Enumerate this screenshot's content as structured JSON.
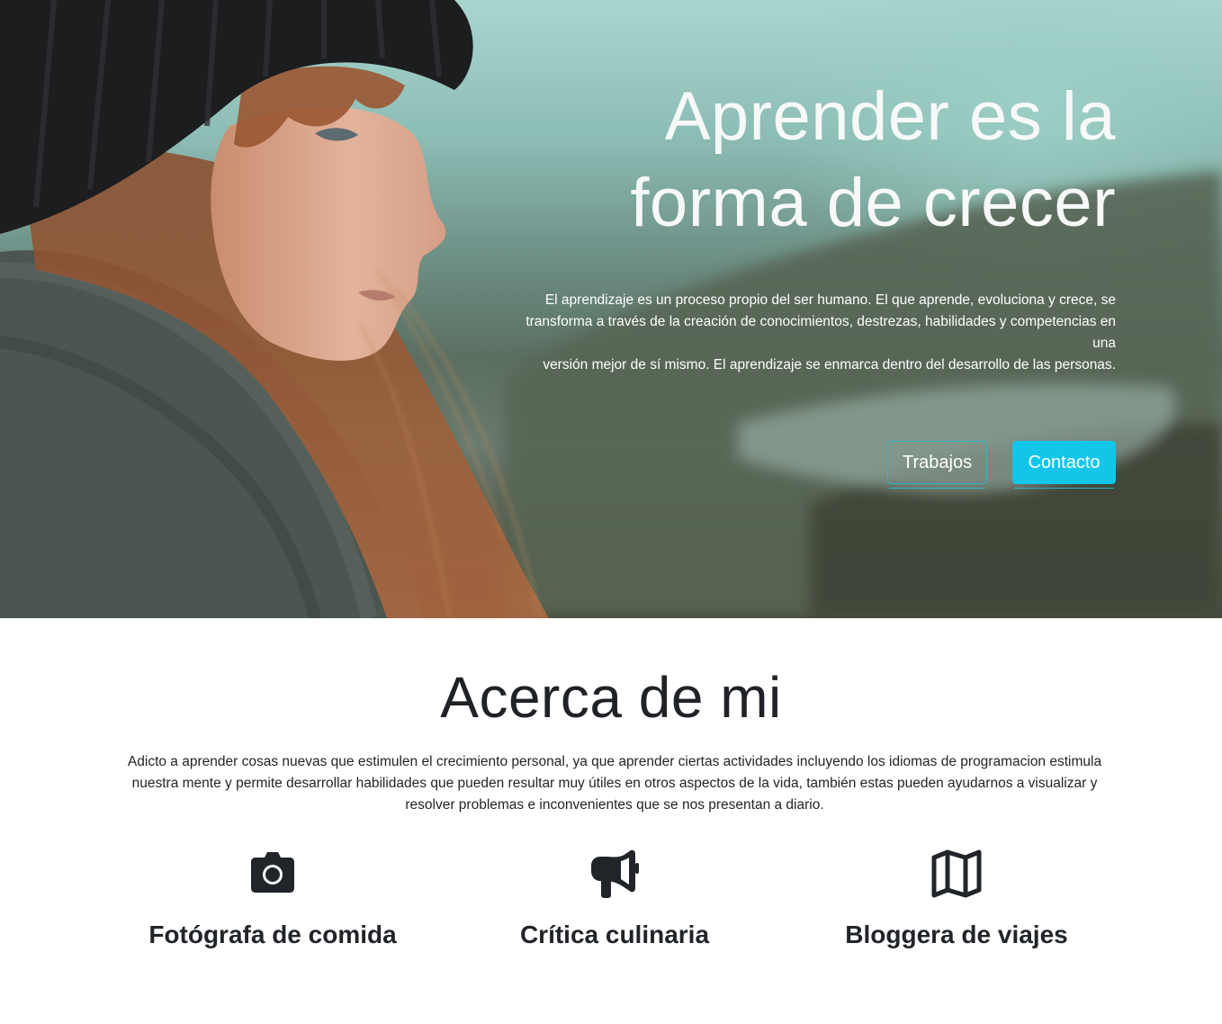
{
  "hero": {
    "title_line1": "Aprender es la",
    "title_line2": "forma de crecer",
    "paragraph_line1": "El aprendizaje es un proceso propio del ser humano. El que aprende, evoluciona y crece, se transforma a través de la creación de conocimientos, destrezas, habilidades y competencias en una",
    "paragraph_line2": "versión mejor de sí mismo. El aprendizaje se enmarca dentro del desarrollo de las personas.",
    "buttons": {
      "works_label": "Trabajos",
      "contact_label": "Contacto"
    }
  },
  "about": {
    "title": "Acerca de mi",
    "text": "Adicto a aprender cosas nuevas que estimulen el crecimiento personal, ya que aprender ciertas actividades incluyendo los idiomas de programacion estimula nuestra mente y permite desarrollar habilidades que pueden resultar muy útiles en otros aspectos de la vida, también estas pueden ayudarnos a visualizar y resolver problemas e inconvenientes que se nos presentan a diario.",
    "features": [
      {
        "icon": "camera-icon",
        "label": "Fotógrafa de comida"
      },
      {
        "icon": "megaphone-icon",
        "label": "Crítica culinaria"
      },
      {
        "icon": "map-icon",
        "label": "Bloggera de viajes"
      }
    ]
  },
  "colors": {
    "accent": "#12c6ea",
    "outline_border": "#2fb6c9",
    "text_dark": "#212529"
  }
}
